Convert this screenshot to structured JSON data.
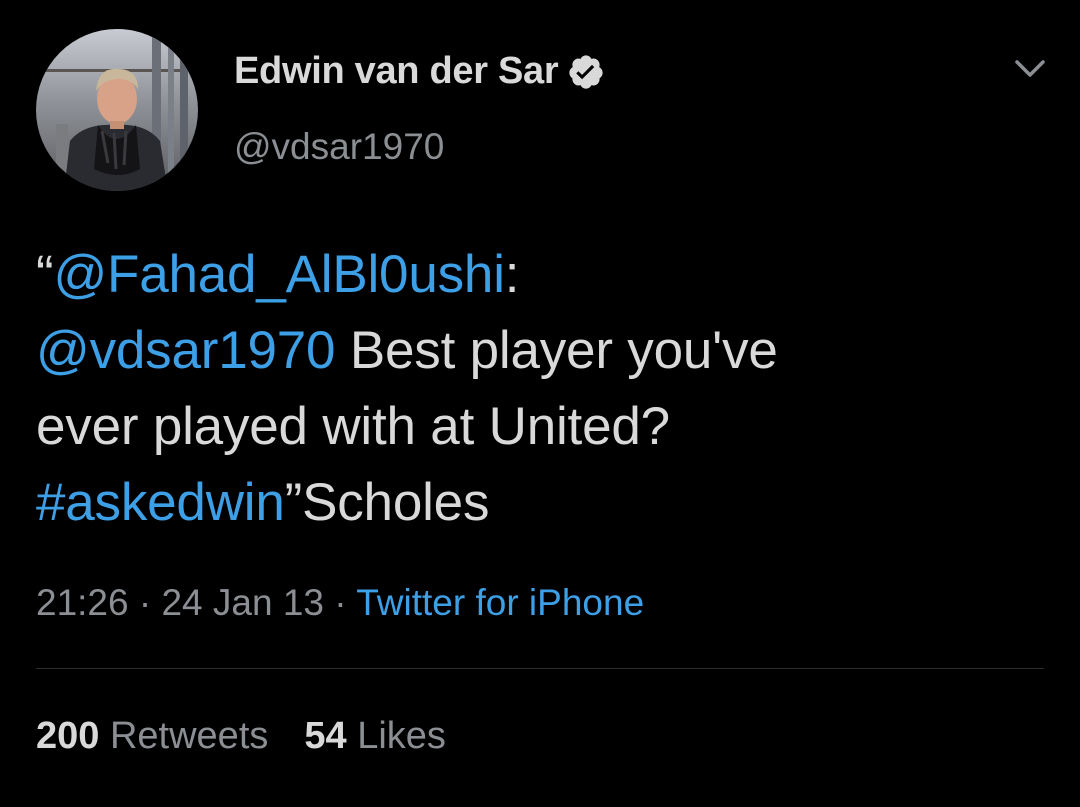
{
  "author": {
    "display_name": "Edwin van der Sar",
    "username": "@vdsar1970",
    "verified_icon": "verified-badge-icon",
    "avatar": "profile-photo"
  },
  "menu_icon": "chevron-down-icon",
  "tweet": {
    "line1": {
      "open_quote": "“",
      "mention": "@Fahad_AlBl0ushi",
      "after": ":"
    },
    "line2": {
      "mention": "@vdsar1970",
      "after": " Best player you've"
    },
    "line3": {
      "text": "ever played with at United?"
    },
    "line4": {
      "hashtag": "#askedwin",
      "after": "”Scholes"
    }
  },
  "meta": {
    "time": "21:26",
    "sep1": " · ",
    "date": "24 Jan 13",
    "sep2": " · ",
    "source": "Twitter for iPhone"
  },
  "stats": {
    "retweets_count": "200",
    "retweets_label": "Retweets",
    "likes_count": "54",
    "likes_label": "Likes"
  },
  "colors": {
    "background": "#000000",
    "text": "#d9d9d9",
    "secondary": "#8b8f93",
    "link": "#3d9fe6",
    "divider": "#2b2e32"
  }
}
